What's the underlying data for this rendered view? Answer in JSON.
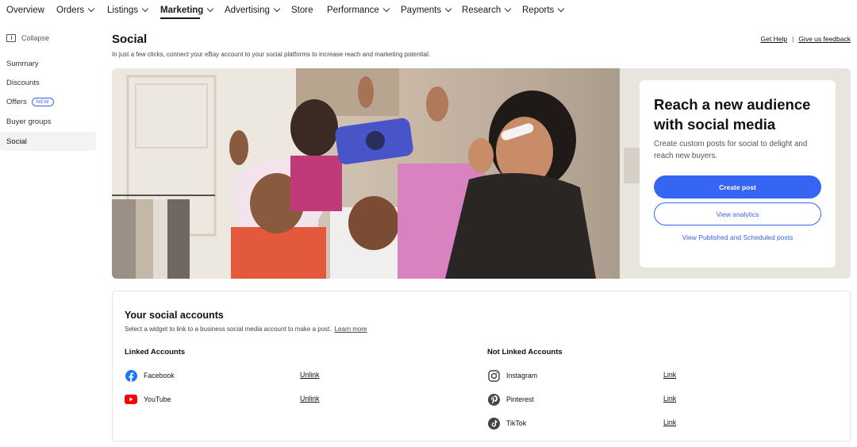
{
  "topnav": {
    "items": [
      {
        "label": "Overview",
        "dropdown": false
      },
      {
        "label": "Orders",
        "dropdown": true
      },
      {
        "label": "Listings",
        "dropdown": true
      },
      {
        "label": "Marketing",
        "dropdown": true,
        "active": true
      },
      {
        "label": "Advertising",
        "dropdown": true
      },
      {
        "label": "Store",
        "dropdown": false
      },
      {
        "label": "Performance",
        "dropdown": true
      },
      {
        "label": "Payments",
        "dropdown": true
      },
      {
        "label": "Research",
        "dropdown": true
      },
      {
        "label": "Reports",
        "dropdown": true
      }
    ]
  },
  "sidebar": {
    "collapse_label": "Collapse",
    "items": [
      {
        "label": "Summary"
      },
      {
        "label": "Discounts"
      },
      {
        "label": "Offers",
        "badge": "NEW"
      },
      {
        "label": "Buyer groups"
      },
      {
        "label": "Social",
        "active": true
      }
    ]
  },
  "header": {
    "title": "Social",
    "subtitle": "In just a few clicks, connect your eBay account to your social platforms to increase reach and marketing potential.",
    "get_help": "Get Help",
    "separator": "|",
    "feedback": "Give us feedback"
  },
  "hero": {
    "title": "Reach a new audience with social media",
    "description": "Create custom posts for social to delight and reach new buyers.",
    "primary_button": "Create post",
    "secondary_button": "View analytics",
    "tertiary_link": "View Published and Scheduled posts"
  },
  "accounts": {
    "title": "Your social accounts",
    "subtitle": "Select a widget to link to a business social media account to make a post.",
    "learn_more": "Learn more",
    "linked_title": "Linked Accounts",
    "not_linked_title": "Not Linked Accounts",
    "linked": [
      {
        "name": "Facebook",
        "action": "Unlink",
        "icon": "facebook-icon",
        "color": "#1877f2"
      },
      {
        "name": "YouTube",
        "action": "Unlink",
        "icon": "youtube-icon",
        "color": "#ff0000"
      }
    ],
    "not_linked": [
      {
        "name": "Instagram",
        "action": "Link",
        "icon": "instagram-icon"
      },
      {
        "name": "Pinterest",
        "action": "Link",
        "icon": "pinterest-icon"
      },
      {
        "name": "TikTok",
        "action": "Link",
        "icon": "tiktok-icon"
      }
    ]
  },
  "colors": {
    "accent": "#3665f3",
    "text": "#111820"
  }
}
